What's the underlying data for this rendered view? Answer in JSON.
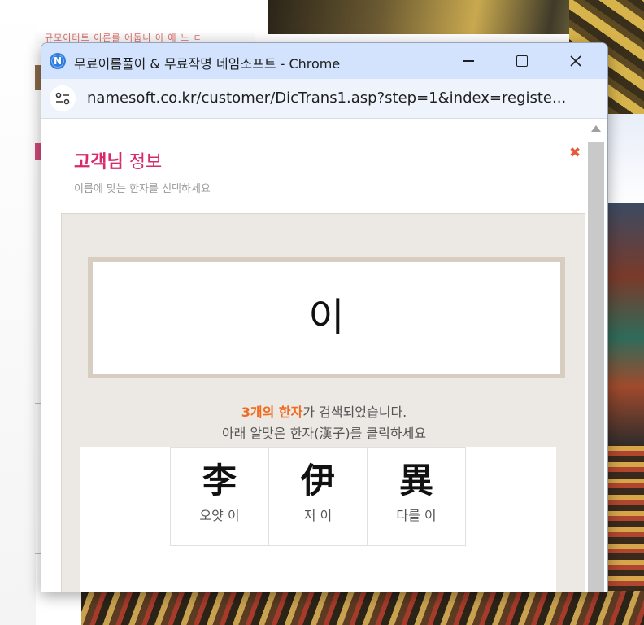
{
  "background": {
    "page_snippet": "규모이터토 이른를 어둡니 이 에 느 ㄷ"
  },
  "window": {
    "favicon_letter": "N",
    "title": "무료이름풀이 & 무료작명 네임소프트 - Chrome",
    "url": "namesoft.co.kr/customer/DicTrans1.asp?step=1&index=registe..."
  },
  "page": {
    "title_strong": "고객님",
    "title_light": " 정보",
    "subtitle": "이름에 맞는 한자를 선택하세요",
    "close_symbol": "✖",
    "name_char": "이",
    "result_highlight": "3개의 한자",
    "result_rest": "가 검색되었습니다.",
    "hint": "아래 알맞은 한자(漢子)를 클릭하세요",
    "hanja": [
      {
        "char": "李",
        "meaning": "오얏 이"
      },
      {
        "char": "伊",
        "meaning": "저 이"
      },
      {
        "char": "異",
        "meaning": "다를 이"
      }
    ]
  },
  "colors": {
    "title_accent": "#d8296a",
    "result_highlight": "#ef6b22",
    "close_icon": "#e65a37",
    "titlebar": "#d3e3fd"
  }
}
